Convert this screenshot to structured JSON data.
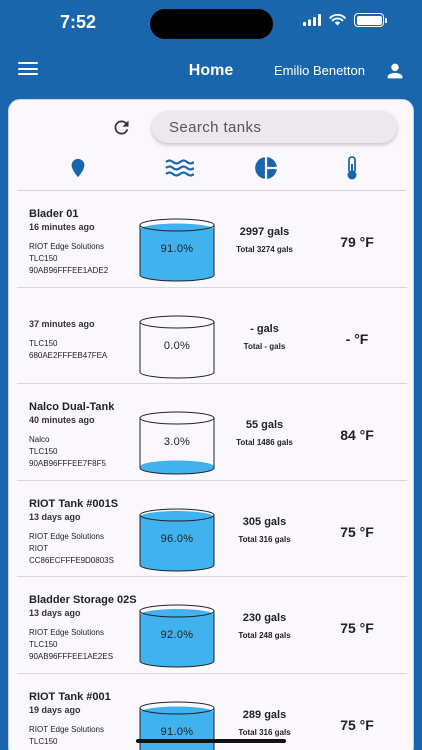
{
  "status": {
    "time": "7:52"
  },
  "header": {
    "title": "Home",
    "user_name": "Emilio Benetton"
  },
  "search": {
    "placeholder": "Search tanks"
  },
  "colors": {
    "primary": "#1a66ad",
    "liquid": "#3fb2ef",
    "icon": "#1a66ad"
  },
  "sort_icons": [
    "location-pin-icon",
    "water-waves-icon",
    "pie-chart-icon",
    "thermometer-icon"
  ],
  "tanks": [
    {
      "name": "Blader 01",
      "time": "16 minutes ago",
      "company": "RIOT Edge Solutions",
      "model": "TLC150",
      "id": "90AB96FFFEE1ADE2",
      "percent_label": "91.0%",
      "fill": 0.91,
      "volume": "2997 gals",
      "total": "Total 3274 gals",
      "temp": "79 °F"
    },
    {
      "name": "",
      "time": "37 minutes ago",
      "company": "",
      "model": "TLC150",
      "id": "680AE2FFFEB47FEA",
      "percent_label": "0.0%",
      "fill": 0.0,
      "volume": "- gals",
      "total": "Total - gals",
      "temp": "- °F"
    },
    {
      "name": "Nalco Dual-Tank",
      "time": "40 minutes ago",
      "company": "Nalco",
      "model": "TLC150",
      "id": "90AB96FFFEE7F8F5",
      "percent_label": "3.0%",
      "fill": 0.03,
      "volume": "55 gals",
      "total": "Total 1486 gals",
      "temp": "84 °F"
    },
    {
      "name": "RIOT Tank #001S",
      "time": "13 days ago",
      "company": "RIOT Edge Solutions",
      "model": "RIOT",
      "id": "CC86ECFFFE9D0803S",
      "percent_label": "96.0%",
      "fill": 0.96,
      "volume": "305 gals",
      "total": "Total 316 gals",
      "temp": "75 °F"
    },
    {
      "name": "Bladder Storage 02S",
      "time": "13 days ago",
      "company": "RIOT Edge Solutions",
      "model": "TLC150",
      "id": "90AB96FFFEE1AE2ES",
      "percent_label": "92.0%",
      "fill": 0.92,
      "volume": "230 gals",
      "total": "Total 248 gals",
      "temp": "75 °F"
    },
    {
      "name": "RIOT Tank #001",
      "time": "19 days ago",
      "company": "RIOT Edge Solutions",
      "model": "TLC150",
      "id": "",
      "percent_label": "91.0%",
      "fill": 0.91,
      "volume": "289 gals",
      "total": "Total 316 gals",
      "temp": "75 °F"
    }
  ]
}
